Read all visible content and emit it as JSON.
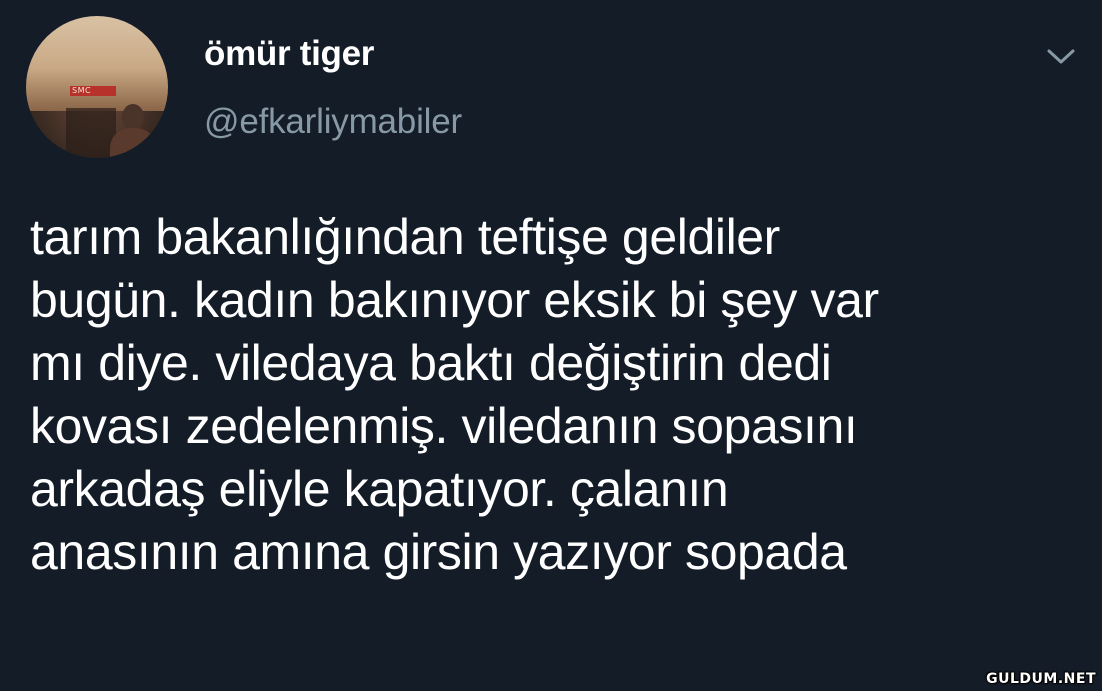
{
  "user": {
    "display_name": "ömür tiger",
    "handle": "@efkarliymabiler",
    "avatar_sign_text": "SMC"
  },
  "menu": {
    "icon": "chevron-down-icon"
  },
  "tweet": {
    "lines": [
      "tarım bakanlığından teftişe geldiler",
      "bugün. kadın bakınıyor eksik bi şey var",
      "mı diye. viledaya baktı değiştirin dedi",
      "kovası zedelenmiş. viledanın sopasını",
      "arkadaş eliyle kapatıyor. çalanın",
      "anasının amına girsin yazıyor sopada"
    ]
  },
  "watermark": {
    "text": "GULDUM.NET"
  },
  "colors": {
    "background": "#131c27",
    "name": "#ffffff",
    "handle": "#8899a6",
    "text": "#ffffff",
    "chevron": "#8899a6"
  }
}
